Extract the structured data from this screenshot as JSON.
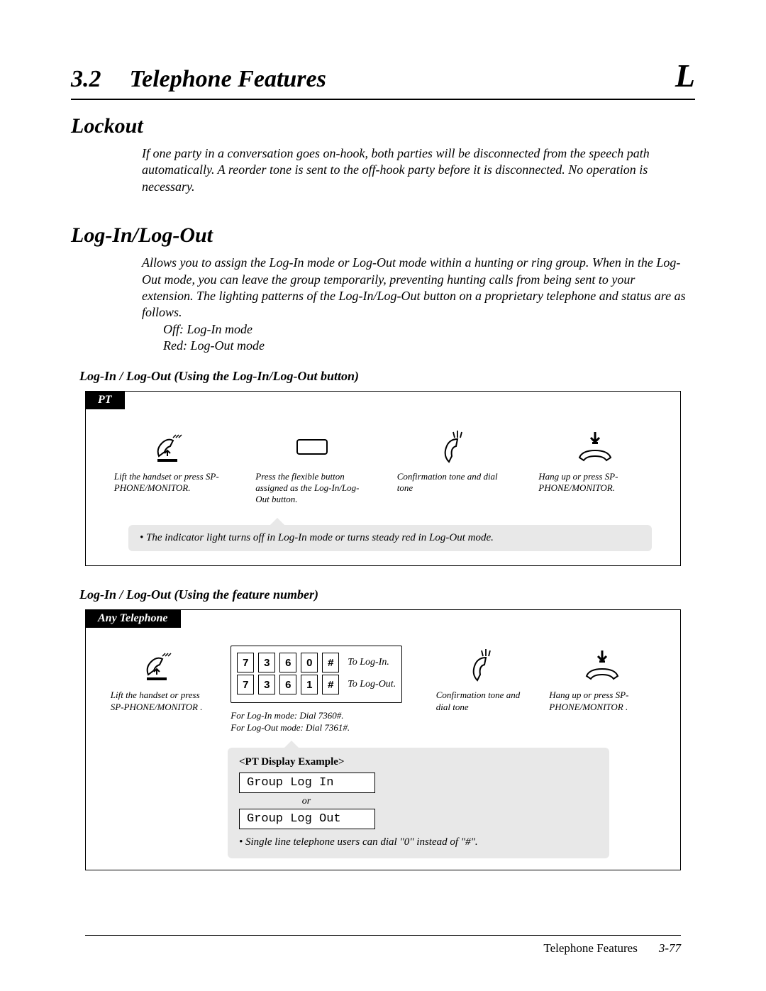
{
  "header": {
    "section_number": "3.2",
    "section_title": "Telephone Features",
    "letter": "L"
  },
  "lockout": {
    "heading": "Lockout",
    "body": "If one party in a conversation goes on-hook, both parties will be disconnected from the speech path automatically. A reorder tone is sent to the off-hook party before it is disconnected. No operation is necessary."
  },
  "login_logout": {
    "heading": "Log-In/Log-Out",
    "body": "Allows you to assign the Log-In mode or Log-Out mode within a hunting or ring group. When in the Log-Out mode, you can leave the group temporarily, preventing hunting calls from being sent to your extension. The lighting patterns of the Log-In/Log-Out button on a proprietary telephone and status are as follows.",
    "mode_off": "Off:  Log-In mode",
    "mode_red": "Red: Log-Out mode"
  },
  "method_button": {
    "title": "Log-In / Log-Out (Using the Log-In/Log-Out button)",
    "tab": "PT",
    "step1": "Lift the handset or press SP-PHONE/MONITOR.",
    "step2": "Press the flexible button assigned as the Log-In/Log-Out button.",
    "step3": "Confirmation tone and dial tone",
    "step4": "Hang up or press SP-PHONE/MONITOR.",
    "note": "•  The indicator light turns off in Log-In mode or turns steady red in Log-Out mode."
  },
  "method_feature": {
    "title": "Log-In / Log-Out (Using the feature number)",
    "tab": "Any Telephone",
    "step1": "Lift the handset or press SP-PHONE/MONITOR .",
    "dial_login": {
      "keys": [
        "7",
        "3",
        "6",
        "0",
        "#"
      ],
      "label": "To Log-In."
    },
    "dial_logout": {
      "keys": [
        "7",
        "3",
        "6",
        "1",
        "#"
      ],
      "label": "To Log-Out."
    },
    "step2a": "For Log-In mode: Dial 7360#.",
    "step2b": "For Log-Out mode: Dial 7361#.",
    "step3": "Confirmation tone and dial tone",
    "step4": "Hang up or press SP-PHONE/MONITOR .",
    "display": {
      "title": "<PT Display Example>",
      "line1": "Group Log In",
      "or": "or",
      "line2": "Group Log Out",
      "note": "•  Single line telephone users can dial \"0\" instead of \"#\"."
    }
  },
  "footer": {
    "title": "Telephone Features",
    "page": "3-77"
  }
}
